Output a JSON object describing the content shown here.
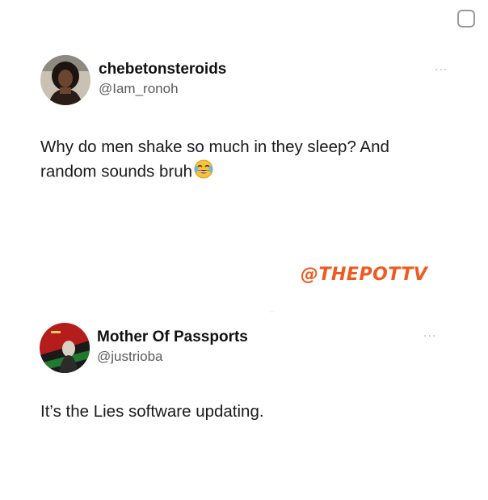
{
  "colors": {
    "watermark": "#f05a1f",
    "handle": "#5b5b5b",
    "text": "#1a1a1a"
  },
  "tweet1": {
    "name": "chebetonsteroids",
    "handle": "@Iam_ronoh",
    "text": "Why do men shake so much in they sleep? And random sounds bruh",
    "emoji": "face-with-tears-of-joy",
    "more_label": "..."
  },
  "watermark": "@THEPOTTV",
  "separator": "..",
  "tweet2": {
    "name": "Mother Of Passports",
    "handle": "@justrioba",
    "text": "It’s the Lies software updating.",
    "more_label": "..."
  }
}
